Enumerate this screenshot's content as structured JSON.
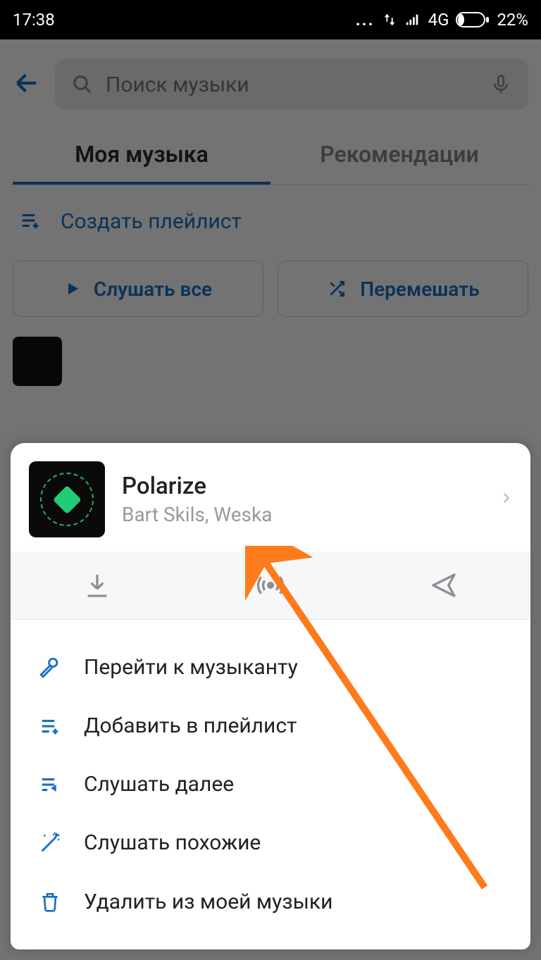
{
  "status_bar": {
    "time": "17:38",
    "network": "4G",
    "battery_pct": "22%"
  },
  "search": {
    "placeholder": "Поиск музыки"
  },
  "tabs": {
    "my_music": "Моя музыка",
    "recommend": "Рекомендации"
  },
  "create_playlist": "Создать плейлист",
  "buttons": {
    "play_all": "Слушать все",
    "shuffle": "Перемешать"
  },
  "sheet": {
    "title": "Polarize",
    "artist": "Bart Skils, Weska",
    "menu": {
      "artist": "Перейти к музыканту",
      "add_playlist": "Добавить в плейлист",
      "play_next": "Слушать далее",
      "similar": "Слушать похожие",
      "delete": "Удалить из моей музыки"
    }
  }
}
